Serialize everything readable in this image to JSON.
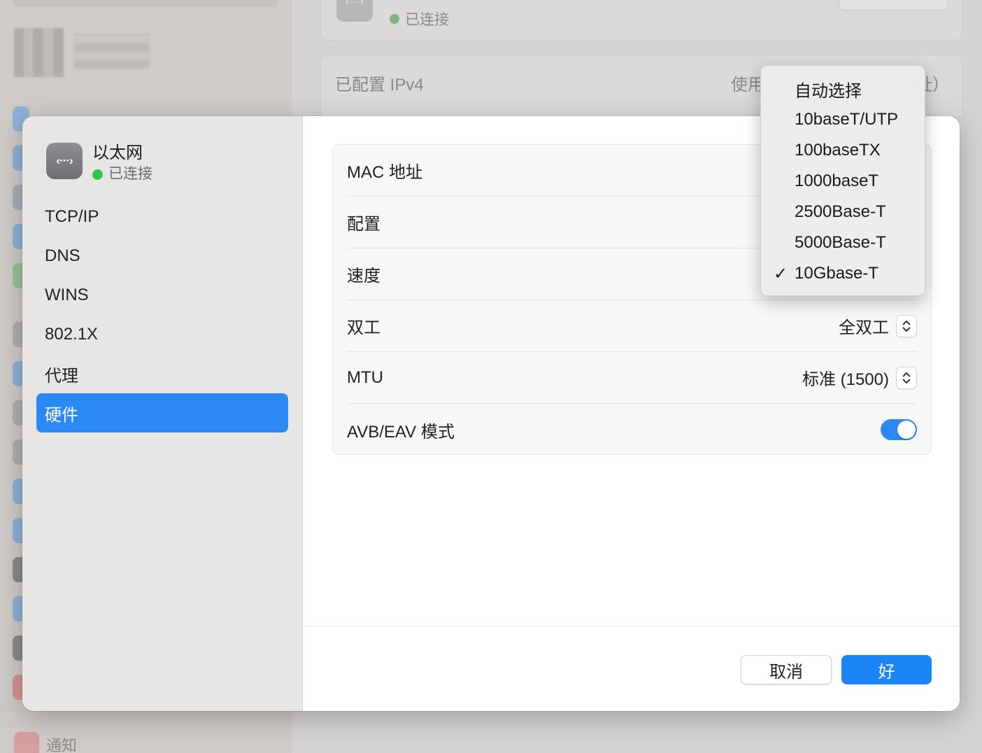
{
  "background": {
    "top_card": {
      "icon": "ethernet-icon",
      "status": "已连接"
    },
    "ipv4_card": {
      "label": "已配置 IPv4",
      "value_left": "使用",
      "value_right": "址）"
    },
    "sidebar_bottom_item": "通知"
  },
  "sheet": {
    "interface": {
      "name": "以太网",
      "status": "已连接",
      "icon": "ethernet-icon",
      "icon_glyph": "‹···›"
    },
    "nav": [
      {
        "label": "TCP/IP"
      },
      {
        "label": "DNS"
      },
      {
        "label": "WINS"
      },
      {
        "label": "802.1X"
      },
      {
        "label": "代理"
      },
      {
        "label": "硬件",
        "selected": true
      }
    ],
    "rows": {
      "mac": {
        "label": "MAC 地址"
      },
      "config": {
        "label": "配置"
      },
      "speed": {
        "label": "速度"
      },
      "duplex": {
        "label": "双工",
        "value": "全双工"
      },
      "mtu": {
        "label": "MTU",
        "value": "标准 (1500)"
      },
      "avb": {
        "label": "AVB/EAV 模式",
        "enabled": true
      }
    },
    "buttons": {
      "cancel": "取消",
      "ok": "好"
    }
  },
  "speed_menu": {
    "options": [
      "自动选择",
      "10baseT/UTP",
      "100baseTX",
      "1000baseT",
      "2500Base-T",
      "5000Base-T",
      "10Gbase-T"
    ],
    "selected": "10Gbase-T",
    "check_glyph": "✓"
  },
  "colors": {
    "accent": "#2c88f2",
    "status_green": "#2fc84d"
  }
}
